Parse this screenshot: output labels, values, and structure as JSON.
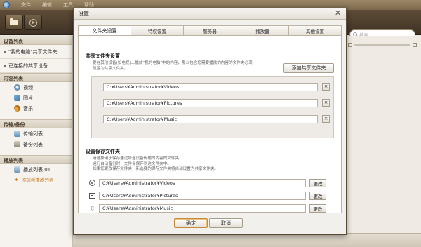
{
  "app": {
    "menu": [
      "文件",
      "编辑",
      "工具",
      "帮助"
    ],
    "search_placeholder": "搜索"
  },
  "sidebar": {
    "devices": {
      "header": "设备列表",
      "my_computer": "\"我的电脑\"共享文件夹",
      "connected": "已连接的共享设备"
    },
    "content": {
      "header": "内容列表",
      "items": [
        "视频",
        "图片",
        "音乐"
      ]
    },
    "transfer": {
      "header": "传输/备份",
      "items": [
        "传输列表",
        "备份列表"
      ]
    },
    "playlists": {
      "header": "播放列表",
      "item": "播放列表 01",
      "add": "添加新播放列表"
    }
  },
  "dialog": {
    "title": "设置",
    "close_glyph": "✕",
    "tabs": [
      "文件夹设置",
      "特权设置",
      "服务器",
      "播放器",
      "其他设置"
    ],
    "active_tab": 0,
    "share": {
      "title": "共享文件夹设置",
      "desc_line1": "要在其他设备(如电视)上播放\"我的电脑\"中的内容，那么包含您需要播放的内容的文件夹必须",
      "desc_line2": "设置为共享文件夹。",
      "add_button": "添加共享文件夹",
      "folders": [
        "C:¥Users¥Administrator¥Videos",
        "C:¥Users¥Administrator¥Pictures",
        "C:¥Users¥Administrator¥Music"
      ],
      "remove_glyph": "×"
    },
    "save": {
      "title": "设置保存文件夹",
      "desc_line1": "请选择用于保存通过所连设备传输的内容的文件夹。",
      "desc_line2": "运行自动备份时，文件会保存到这文件夹中。",
      "desc_line3": "如果您更改保存文件夹，新选择的保存文件夹将自动设置为共享文件夹。",
      "rows": [
        {
          "icon": "film-reel-icon",
          "path": "C:¥Users¥Administrator¥Videos"
        },
        {
          "icon": "picture-icon",
          "path": "C:¥Users¥Administrator¥Pictures"
        },
        {
          "icon": "music-note-icon",
          "path": "C:¥Users¥Administrator¥Music"
        }
      ],
      "change_label": "更改"
    },
    "ok_label": "确定",
    "cancel_label": "取消"
  }
}
